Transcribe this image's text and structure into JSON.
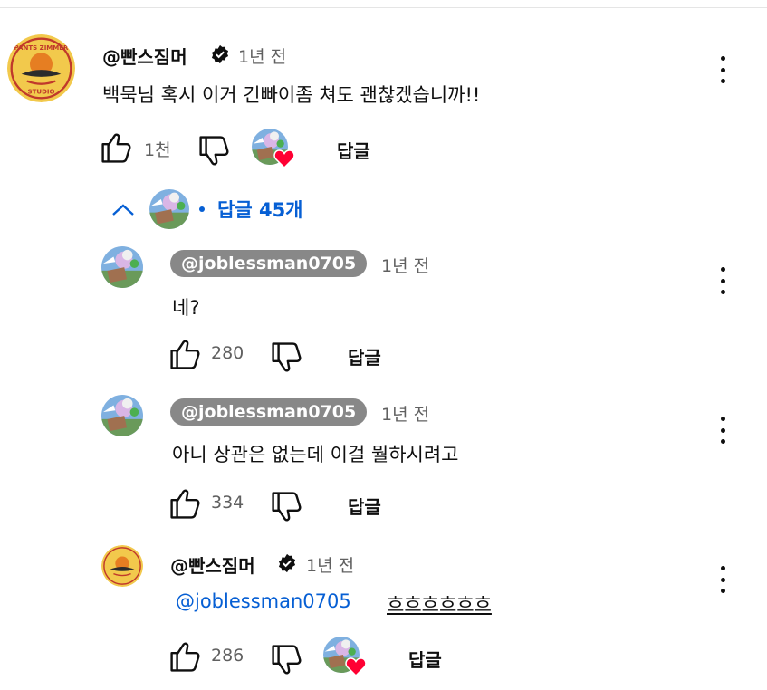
{
  "colors": {
    "link": "#065fd4",
    "pill": "#888888",
    "heart": "#ff0033",
    "text": "#0f0f0f",
    "meta": "#606060"
  },
  "icons": [
    "verified-icon",
    "like-icon",
    "dislike-icon",
    "heart-icon",
    "chevron-up-icon",
    "more-vert-icon"
  ],
  "top_comment": {
    "author": "@빤스짐머",
    "time": "1년 전",
    "text": "백묵님 혹시 이거 긴빠이좀 쳐도 괜찮겠습니까!!",
    "likes": "1천",
    "reply_label": "답글"
  },
  "replies_toggle": {
    "label": "답글 45개"
  },
  "replies": [
    {
      "author": "@joblessman0705",
      "time": "1년 전",
      "text": "네?",
      "likes": "280",
      "reply_label": "답글"
    },
    {
      "author": "@joblessman0705",
      "time": "1년 전",
      "text": "아니 상관은 없는데 이걸 뭘하시려고",
      "likes": "334",
      "reply_label": "답글"
    },
    {
      "author": "@빤스짐머",
      "time": "1년 전",
      "mention": "@joblessman0705",
      "text": "흐흐흐흐흐흐",
      "likes": "286",
      "reply_label": "답글"
    }
  ],
  "logo": {
    "top": "PANTS ZIMMER",
    "bottom": "STUDIO"
  }
}
